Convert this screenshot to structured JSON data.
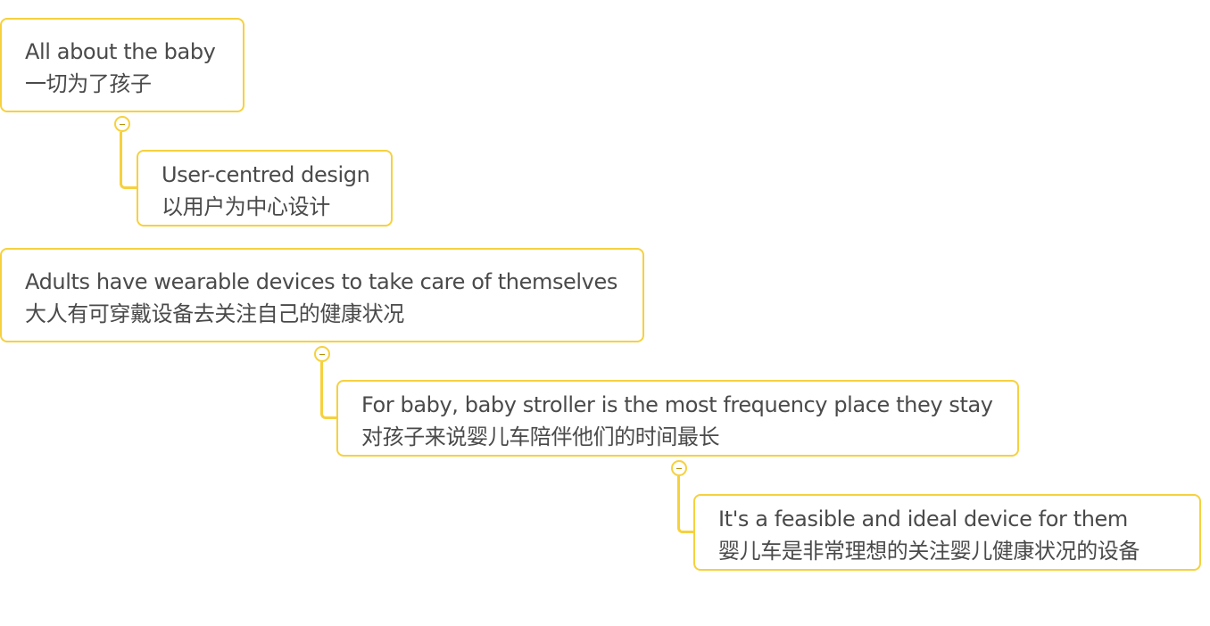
{
  "nodes": [
    {
      "id": "n1",
      "line1": "All about the baby",
      "line2": "一切为了孩子"
    },
    {
      "id": "n2",
      "line1": "User-centred design",
      "line2": "以用户为中心设计"
    },
    {
      "id": "n3",
      "line1": "Adults have wearable devices to take care of themselves",
      "line2": "大人有可穿戴设备去关注自己的健康状况"
    },
    {
      "id": "n4",
      "line1": "For baby, baby stroller is the most frequency place they stay",
      "line2": "对孩子来说婴儿车陪伴他们的时间最长"
    },
    {
      "id": "n5",
      "line1": "It's a feasible and ideal device for them",
      "line2": "婴儿车是非常理想的关注婴儿健康状况的设备"
    }
  ],
  "colors": {
    "border": "#f6d13d",
    "text": "#4a4a4a",
    "toggle_minus": "#b58f00"
  },
  "icons": {
    "collapse": "minus-icon"
  }
}
